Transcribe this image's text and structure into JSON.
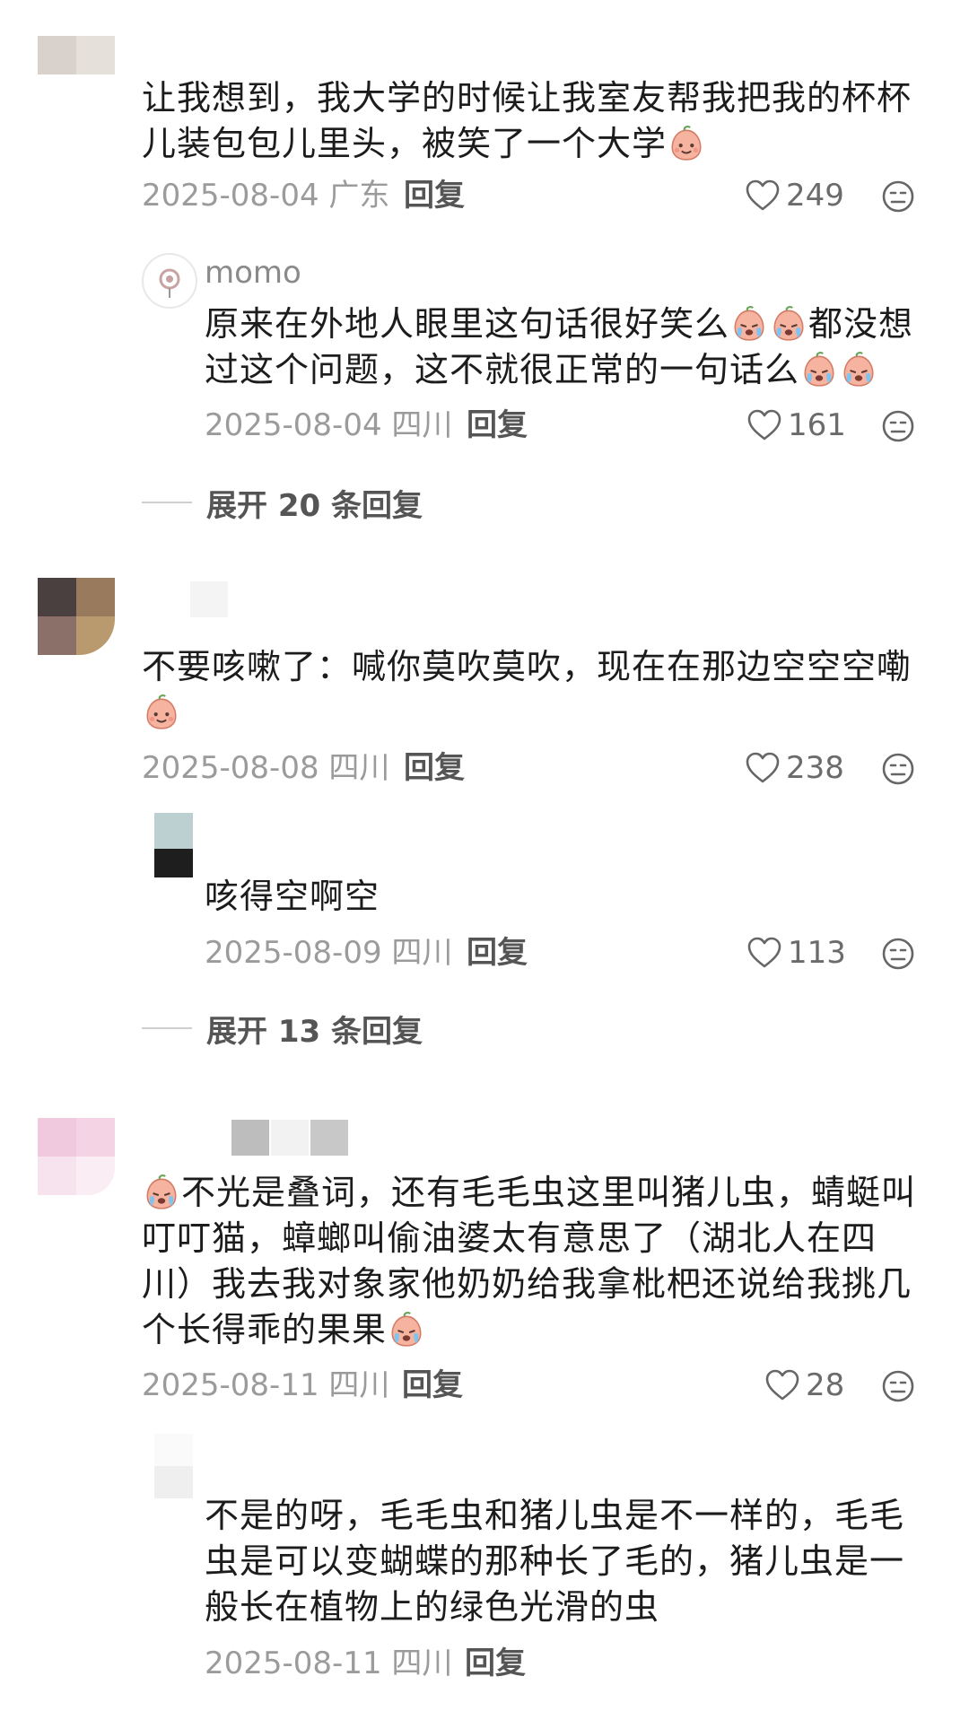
{
  "comments": [
    {
      "text_lines": [
        "让我想到，我大学的时候让我室友帮我把我的杯杯",
        "儿装包包儿里头，被笑了一个大学"
      ],
      "date_location": "2025-08-04 广东",
      "reply_label": "回复",
      "likes": "249",
      "replies": [
        {
          "username": "momo",
          "text_lines": [
            "原来在外地人眼里这句话很好笑么",
            "都没想",
            "过这个问题，这不就很正常的一句话么"
          ],
          "date_location": "2025-08-04 四川",
          "reply_label": "回复",
          "likes": "161"
        }
      ],
      "expand_label": "展开 20 条回复"
    },
    {
      "text_lines": [
        "不要咳嗽了：喊你莫吹莫吹，现在在那边空空空嘞"
      ],
      "date_location": "2025-08-08 四川",
      "reply_label": "回复",
      "likes": "238",
      "replies": [
        {
          "text_lines": [
            "咳得空啊空"
          ],
          "date_location": "2025-08-09 四川",
          "reply_label": "回复",
          "likes": "113"
        }
      ],
      "expand_label": "展开 13 条回复"
    },
    {
      "text_lines": [
        "不光是叠词，还有毛毛虫这里叫猪儿虫，蜻蜓叫",
        "叮叮猫，蟑螂叫偷油婆太有意思了（湖北人在四",
        "川）我去我对象家他奶奶给我拿枇杷还说给我挑几",
        "个长得乖的果果"
      ],
      "date_location": "2025-08-11 四川",
      "reply_label": "回复",
      "likes": "28",
      "replies": [
        {
          "text_lines": [
            "不是的呀，毛毛虫和猪儿虫是不一样的，毛毛",
            "虫是可以变蝴蝶的那种长了毛的，猪儿虫是一",
            "般长在植物上的绿色光滑的虫"
          ],
          "date_location": "2025-08-11 四川",
          "reply_label": "回复"
        }
      ]
    }
  ],
  "colors": {
    "text": "#1c1c1c",
    "meta": "#9b9b9b",
    "accent_emoji": "#f3a58e"
  },
  "icons": [
    "heart-icon",
    "dislike-face-icon",
    "emoji-smile-icon",
    "emoji-cry-icon"
  ]
}
